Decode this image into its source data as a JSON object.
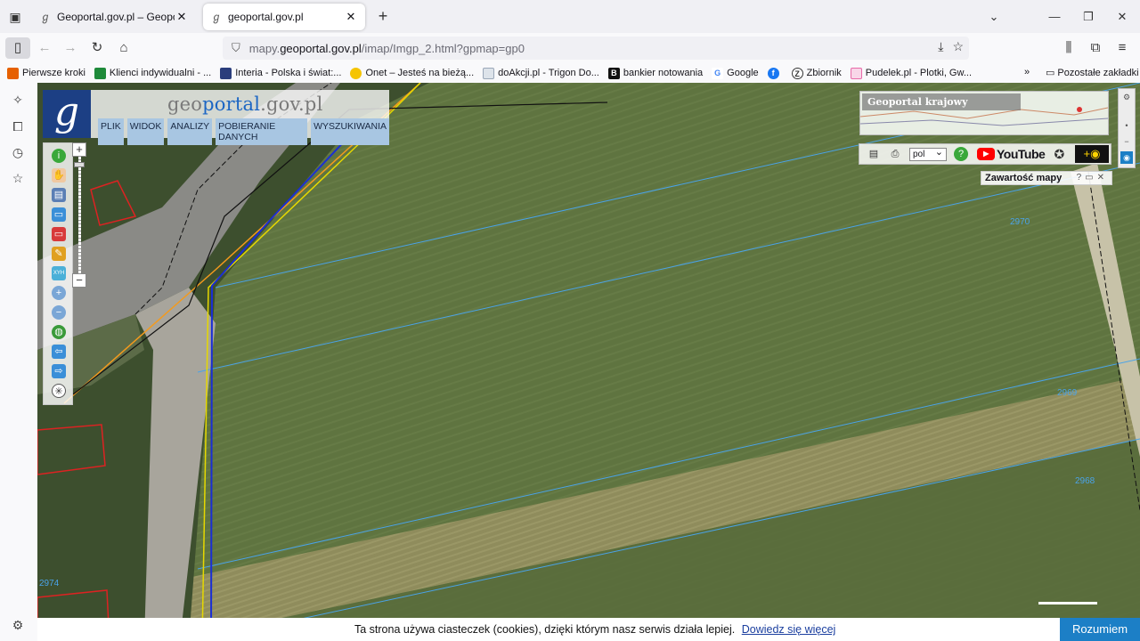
{
  "browser": {
    "tabs": [
      {
        "title": "Geoportal.gov.pl – Geoportal In",
        "active": false
      },
      {
        "title": "geoportal.gov.pl",
        "active": true
      }
    ],
    "url": {
      "prefix": "mapy.",
      "host": "geoportal.gov.pl",
      "path": "/imap/Imgp_2.html?gpmap=gp0"
    },
    "bookmarks": [
      {
        "label": "Pierwsze kroki",
        "icon": "firefox-icon",
        "color": "#e66000"
      },
      {
        "label": "Klienci indywidualni - ...",
        "icon": "bank-icon",
        "color": "#1e8a3a"
      },
      {
        "label": "Interia - Polska i świat:...",
        "icon": "interia-icon",
        "color": "#2a3d7c"
      },
      {
        "label": "Onet – Jesteś na bieżą...",
        "icon": "onet-icon",
        "color": "#f5c400"
      },
      {
        "label": "doAkcji.pl - Trigon Do...",
        "icon": "page-icon",
        "color": "#9aa7b8"
      },
      {
        "label": "bankier notowania",
        "icon": "bankier-icon",
        "color": "#111111"
      },
      {
        "label": "Google",
        "icon": "google-icon",
        "color": "#4285f4"
      },
      {
        "label": "",
        "icon": "facebook-icon",
        "color": "#1877f2"
      },
      {
        "label": "Zbiornik",
        "icon": "zbiornik-icon",
        "color": "#333333"
      },
      {
        "label": "Pudelek.pl - Plotki, Gw...",
        "icon": "pudelek-icon",
        "color": "#e86aa8"
      }
    ],
    "bookmarks_other": "Pozostałe zakładki"
  },
  "geoportal": {
    "logo_letter": "g",
    "title_part1": "geo",
    "title_part2": "portal",
    "title_part3": ".gov.pl",
    "menu": [
      "PLIK",
      "WIDOK",
      "ANALIZY",
      "POBIERANIE DANYCH",
      "WYSZUKIWANIA"
    ],
    "overview_label": "Geoportal krajowy",
    "language": "pol",
    "youtube": "YouTube",
    "contents_panel": "Zawartość mapy",
    "parcel_numbers": [
      "2970",
      "2969",
      "2968",
      "2974"
    ]
  },
  "cookie": {
    "text": "Ta strona używa ciasteczek (cookies), dzięki którym nasz serwis działa lepiej.",
    "link": "Dowiedz się więcej",
    "button": "Rozumiem"
  }
}
